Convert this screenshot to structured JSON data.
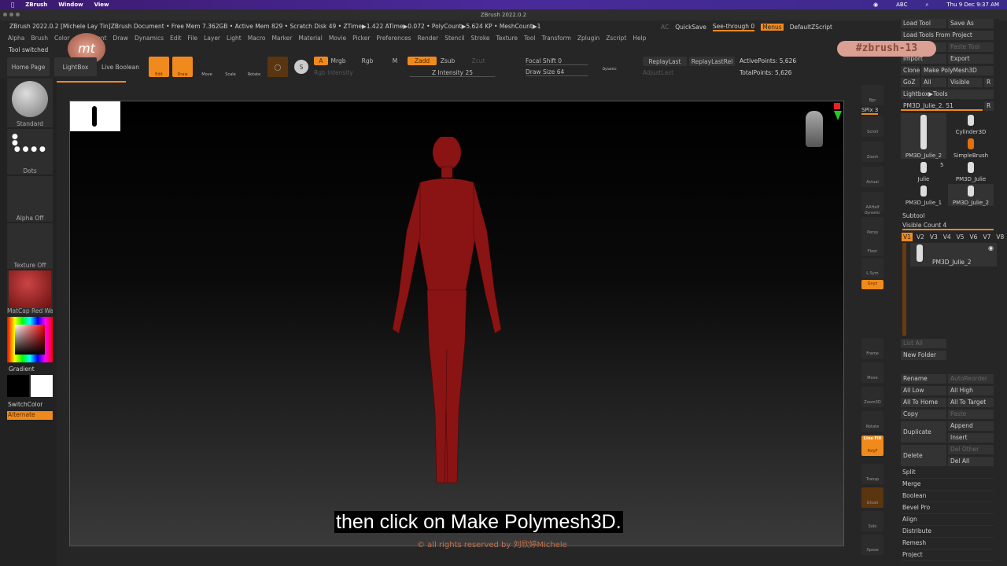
{
  "macbar": {
    "app": "ZBrush",
    "menus": [
      "Window",
      "View"
    ],
    "clock": "Thu 9 Dec 9:37 AM",
    "input": "ABC"
  },
  "window": {
    "title": "ZBrush 2022.0.2"
  },
  "info": {
    "text": "ZBrush 2022.0.2 [Michele Lay Tin]ZBrush Document    • Free Mem 7.362GB • Active Mem 829 • Scratch Disk 49 •  ZTime▶1.422 ATime▶0.072 • PolyCount▶5.624 KP  • MeshCount▶1",
    "ac": "AC",
    "quicksave": "QuickSave",
    "seethrough": "See-through  0",
    "menus": "Menus",
    "script": "DefaultZScript"
  },
  "menus": [
    "Alpha",
    "Brush",
    "Color",
    "Document",
    "Draw",
    "Dynamics",
    "Edit",
    "File",
    "Layer",
    "Light",
    "Macro",
    "Marker",
    "Material",
    "Movie",
    "Picker",
    "Preferences",
    "Render",
    "Stencil",
    "Stroke",
    "Texture",
    "Tool",
    "Transform",
    "Zplugin",
    "Zscript",
    "Help"
  ],
  "status": "Tool switched",
  "toolbar": {
    "home": "Home Page",
    "lightbox": "LightBox",
    "liveboolean": "Live Boolean",
    "edit": "Edit",
    "draw": "Draw",
    "move": "Move",
    "scale": "Scale",
    "rotate": "Rotate",
    "a": "A",
    "mrgb": "Mrgb",
    "rgb": "Rgb",
    "m": "M",
    "rgbint": "Rgb Intensity",
    "zadd": "Zadd",
    "zsub": "Zsub",
    "zcut": "Zcut",
    "zint": "Z Intensity 25",
    "focal": "Focal Shift 0",
    "drawsize": "Draw Size 64",
    "dynamic": "Dynamic",
    "replay": "ReplayLast",
    "replayrel": "ReplayLastRel",
    "adjust": "AdjustLast",
    "active": "ActivePoints: 5,626",
    "total": "TotalPoints: 5,626"
  },
  "left": {
    "brush": "Standard",
    "stroke": "Dots",
    "alpha": "Alpha Off",
    "texture": "Texture Off",
    "material": "MatCap Red Wax",
    "gradient": "Gradient",
    "switch": "SwitchColor",
    "alternate": "Alternate"
  },
  "shelf": [
    "Bpr",
    "Scroll",
    "Zoom",
    "Actual",
    "AAHalf",
    "Persp",
    "Floor",
    "L.Sym",
    "Gxyz",
    "Frame",
    "Move",
    "Zoom3D",
    "Rotate",
    "PolyF",
    "Transp",
    "Ghost",
    "Solo",
    "Xpose"
  ],
  "shelf_extra": {
    "spix": "SPix 3",
    "linefill": "Line Fill",
    "dynamic": "Dynamic"
  },
  "right": {
    "loadtool": "Load Tool",
    "saveas": "Save As",
    "loadproj": "Load Tools From Project",
    "copytool": "Copy Tool",
    "pastetool": "Paste Tool",
    "import": "Import",
    "export": "Export",
    "clone": "Clone",
    "makepoly": "Make PolyMesh3D",
    "goz": "GoZ",
    "all": "All",
    "visible": "Visible",
    "r": "R",
    "lightbox": "Lightbox▶Tools",
    "current": "PM3D_Julie_2. 51",
    "tools": [
      "PM3D_Julie_2",
      "Cylinder3D",
      "SimpleBrush",
      "Julie",
      "PM3D_Julie",
      "PM3D_Julie_1",
      "PM3D_Julie_2"
    ],
    "count5": "5",
    "subtool": "Subtool",
    "viscount": "Visible Count 4",
    "versions": [
      "V1",
      "V2",
      "V3",
      "V4",
      "V5",
      "V6",
      "V7",
      "V8"
    ],
    "subitem": "PM3D_Julie_2",
    "listall": "List All",
    "newfolder": "New Folder",
    "rename": "Rename",
    "autoreorder": "AutoReorder",
    "alllow": "All Low",
    "allhigh": "All High",
    "allhome": "All To Home",
    "alltarget": "All To Target",
    "copy": "Copy",
    "paste": "Paste",
    "duplicate": "Duplicate",
    "append": "Append",
    "insert": "Insert",
    "delete": "Delete",
    "delother": "Del Other",
    "delall": "Del All",
    "actions": [
      "Split",
      "Merge",
      "Boolean",
      "Bevel Pro",
      "Align",
      "Distribute",
      "Remesh",
      "Project"
    ]
  },
  "overlay": {
    "caption": "then click on Make Polymesh3D.",
    "copyright": "© all rights reserved by 刘欣婷Michele",
    "tag": "#zbrush-13",
    "logo": "mt"
  },
  "colors": {
    "accent": "#f08a1c",
    "mesh": "#8a1414"
  }
}
